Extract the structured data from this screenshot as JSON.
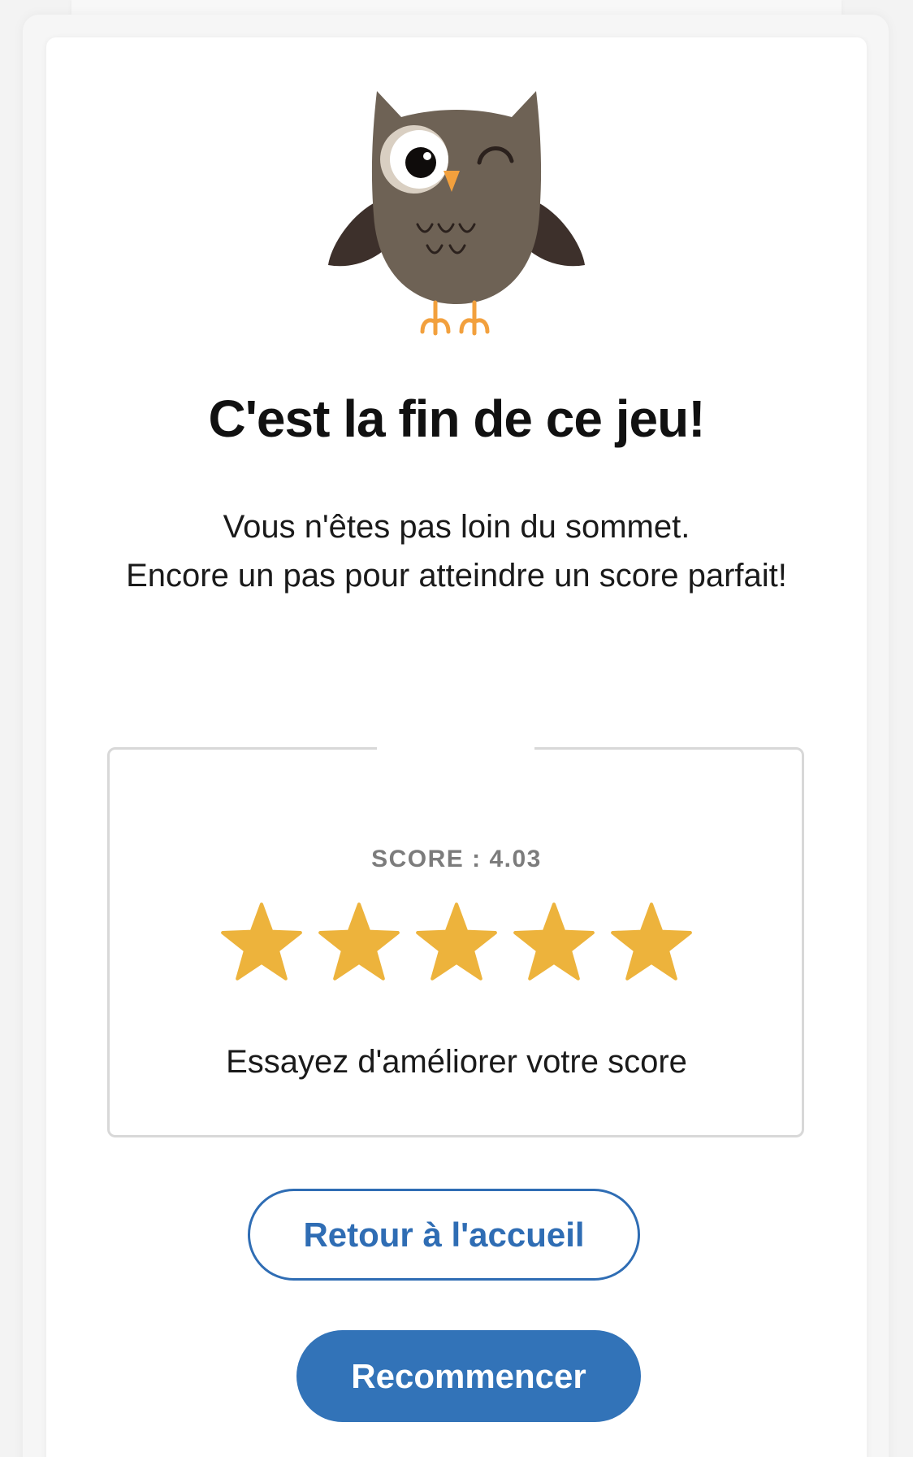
{
  "result": {
    "mascot_icon": "winking-owl-icon",
    "title": "C'est la fin de ce jeu!",
    "subtitle_line1": "Vous n'êtes pas loin du sommet.",
    "subtitle_line2": "Encore un pas pour atteindre un score parfait!"
  },
  "score": {
    "label": "SCORE : 4.03",
    "stars_filled": 5,
    "stars_total": 5,
    "star_icon": "star-icon",
    "feedback": "Essayez d'améliorer votre score"
  },
  "actions": {
    "home_label": "Retour à l'accueil",
    "restart_label": "Recommencer"
  },
  "colors": {
    "star": "#EDB33C",
    "primary": "#3273B8",
    "owl_body": "#6E6255",
    "owl_wing": "#3D302B",
    "owl_beak": "#F2A03D"
  }
}
